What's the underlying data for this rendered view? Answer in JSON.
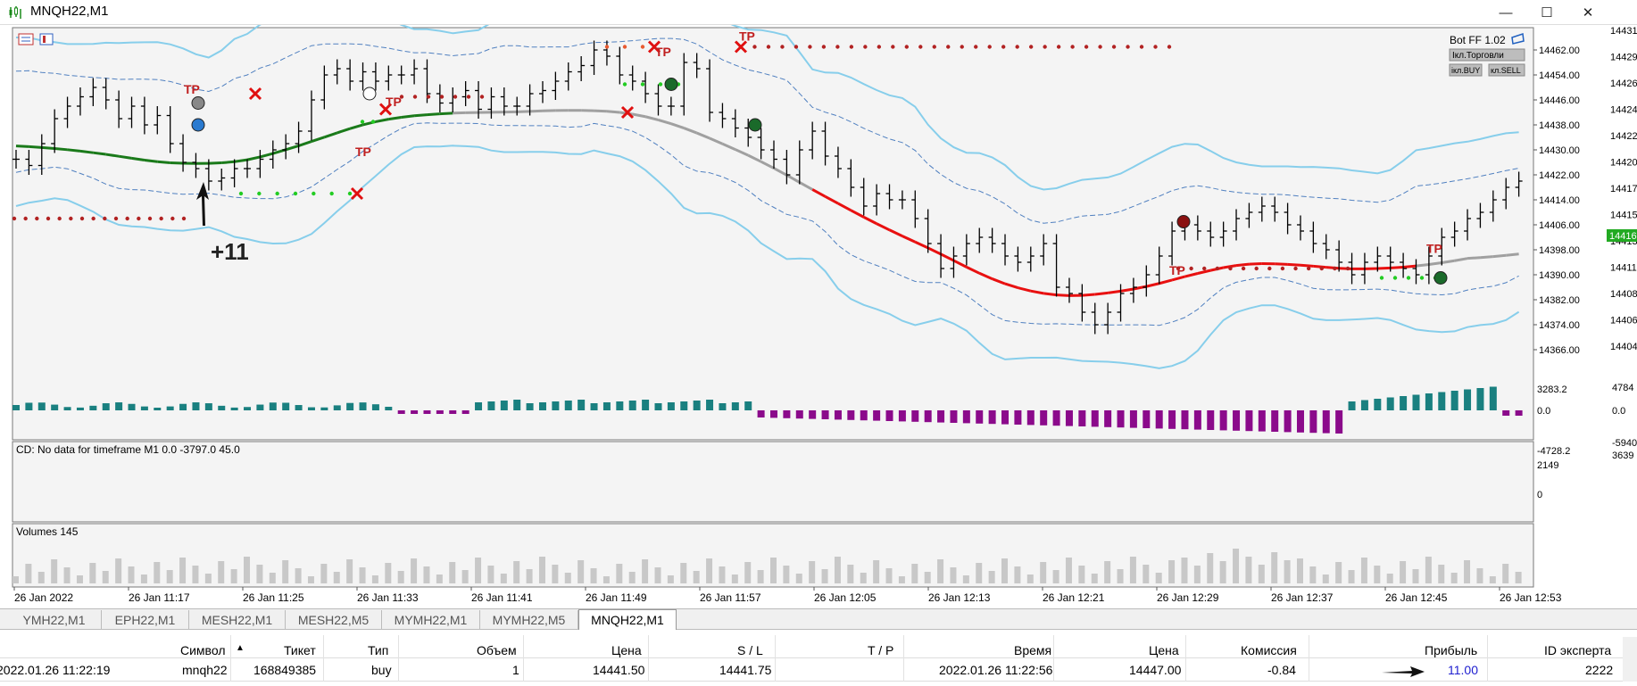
{
  "window": {
    "title": "MNQH22,M1",
    "minimize_glyph": "—",
    "maximize_glyph": "☐",
    "close_glyph": "✕"
  },
  "chart": {
    "indicator_badge": "Bot FF 1.02",
    "panel_button_1": "Ікл.Торговли",
    "panel_button_2": "ікл.BUY",
    "panel_button_3": "кл.SELL",
    "annotation_profit": "+11",
    "tp_label": "TP",
    "cd_label": "CD: No data for timeframe M1 0.0 -3797.0 45.0",
    "volumes_label": "Volumes 145",
    "price_axis": [
      "14462.00",
      "14454.00",
      "14446.00",
      "14438.00",
      "14430.00",
      "14422.00",
      "14414.00",
      "14406.00",
      "14398.00",
      "14390.00",
      "14382.00",
      "14374.00",
      "14366.00"
    ],
    "current_price": "14416",
    "right_axis_partial": [
      "14431",
      "14429",
      "14426",
      "14424",
      "14422",
      "14420",
      "14417",
      "14415",
      "14413",
      "14411",
      "14408",
      "14406",
      "14404"
    ],
    "cd_axis": [
      "3283.2",
      "0.0",
      "-4728.2"
    ],
    "cd_axis_partial": [
      "4784",
      "0.0",
      "-5940"
    ],
    "vol_axis": [
      "2149",
      "0"
    ],
    "vol_axis_partial": [
      "3639"
    ],
    "time_axis": [
      "26 Jan 2022",
      "26 Jan 11:17",
      "26 Jan 11:25",
      "26 Jan 11:33",
      "26 Jan 11:41",
      "26 Jan 11:49",
      "26 Jan 11:57",
      "26 Jan 12:05",
      "26 Jan 12:13",
      "26 Jan 12:21",
      "26 Jan 12:29",
      "26 Jan 12:37",
      "26 Jan 12:45",
      "26 Jan 12:53"
    ],
    "colors": {
      "bollinger": "#87ceeb",
      "ma_up": "#1a7a1a",
      "ma_down": "#e81010",
      "ma_neutral": "#a0a0a0",
      "cd_positive": "#1a8080",
      "cd_negative": "#8b0a8b",
      "volume": "#c8c8c8",
      "dots_red": "#b22222",
      "dots_green": "#22cc22"
    }
  },
  "tabs": [
    "YMH22,M1",
    "EPH22,M1",
    "MESH22,M1",
    "MESH22,M5",
    "MYMH22,M1",
    "MYMH22,M5",
    "MNQH22,M1"
  ],
  "active_tab": "MNQH22,M1",
  "table": {
    "headers": {
      "symbol": "Символ",
      "ticket": "Тикет",
      "type": "Тип",
      "volume": "Объем",
      "price": "Цена",
      "sl": "S / L",
      "tp": "T / P",
      "time": "Время",
      "close_price": "Цена",
      "commission": "Комиссия",
      "profit": "Прибыль",
      "expert_id": "ID эксперта"
    },
    "row": {
      "open_time": "2022.01.26 11:22:19",
      "symbol": "mnqh22",
      "ticket": "168849385",
      "type": "buy",
      "volume": "1",
      "price": "14441.50",
      "sl": "14441.75",
      "tp": "",
      "time": "2022.01.26 11:22:56",
      "close_price": "14447.00",
      "commission": "-0.84",
      "profit": "11.00",
      "expert_id": "2222"
    }
  }
}
